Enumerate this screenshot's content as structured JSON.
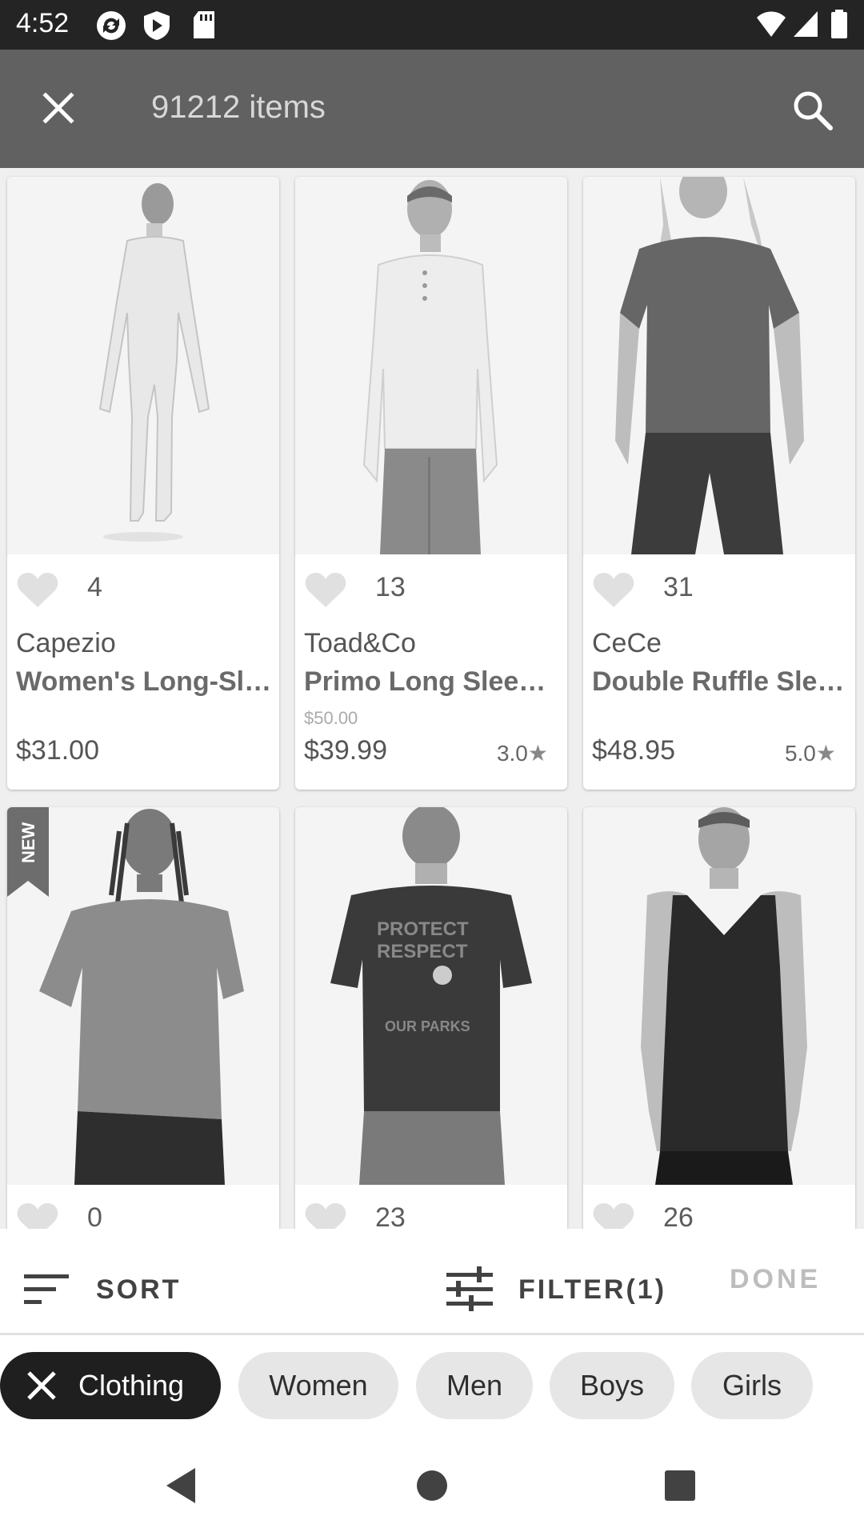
{
  "status_bar": {
    "time": "4:52"
  },
  "app_bar": {
    "title": "91212 items",
    "close_icon": "close-icon",
    "search_icon": "search-icon"
  },
  "products": [
    {
      "likes": "4",
      "brand": "Capezio",
      "name": "Women's Long-Sleeve Unitard",
      "original_price": "",
      "price": "$31.00",
      "rating": "",
      "is_new": false
    },
    {
      "likes": "13",
      "brand": "Toad&Co",
      "name": "Primo Long Sleeve Henley",
      "original_price": "$50.00",
      "price": "$39.99",
      "rating": "3.0",
      "is_new": false
    },
    {
      "likes": "31",
      "brand": "CeCe",
      "name": "Double Ruffle Sleeve Tee",
      "original_price": "",
      "price": "$48.95",
      "rating": "5.0",
      "is_new": false
    },
    {
      "likes": "0",
      "brand": "",
      "name": "",
      "original_price": "",
      "price": "",
      "rating": "",
      "is_new": true,
      "badge": "NEW"
    },
    {
      "likes": "23",
      "brand": "",
      "name": "",
      "original_price": "",
      "price": "",
      "rating": "",
      "is_new": false
    },
    {
      "likes": "26",
      "brand": "",
      "name": "",
      "original_price": "",
      "price": "",
      "rating": "",
      "is_new": false
    }
  ],
  "rating_star": "★",
  "toolbar": {
    "sort_label": "SORT",
    "filter_label": "FILTER(1)",
    "done_label": "DONE"
  },
  "chips": [
    {
      "label": "Clothing",
      "active": true
    },
    {
      "label": "Women",
      "active": false
    },
    {
      "label": "Men",
      "active": false
    },
    {
      "label": "Boys",
      "active": false
    },
    {
      "label": "Girls",
      "active": false
    }
  ],
  "colors": {
    "app_bar": "#616161",
    "status_bar": "#242424",
    "chip_active": "#1f1f1f",
    "chip": "#e6e6e6"
  }
}
